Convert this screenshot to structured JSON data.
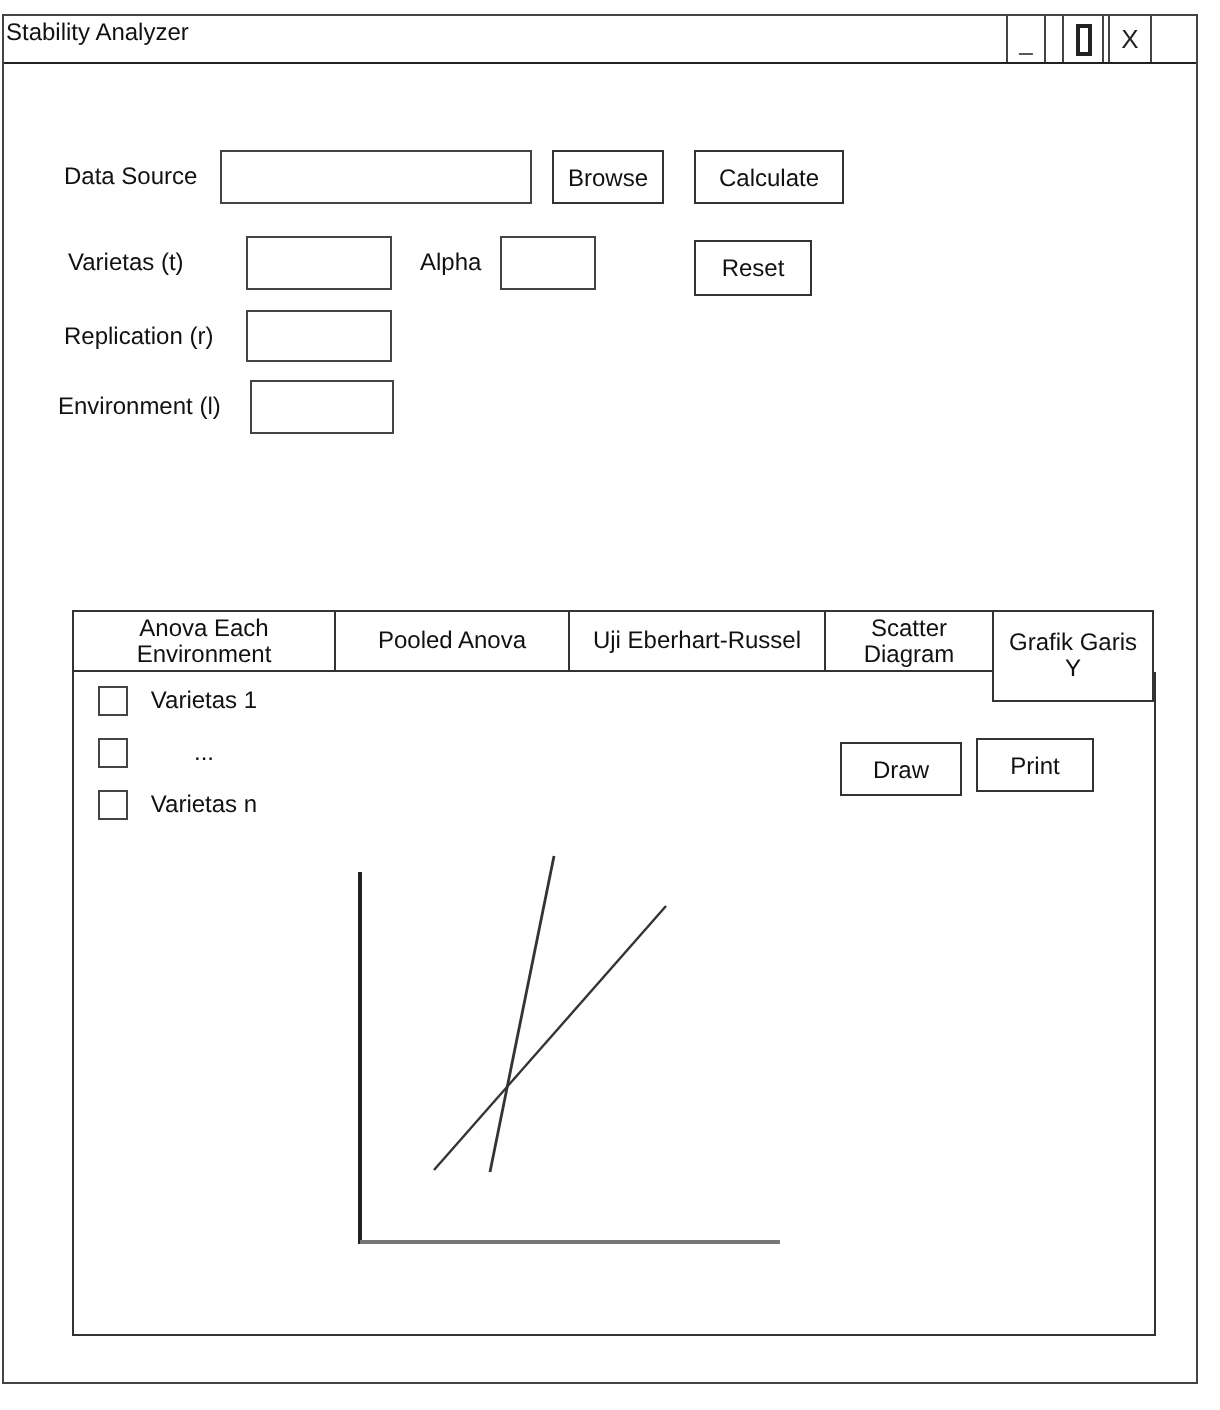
{
  "window": {
    "title": "Stability Analyzer",
    "minimize": "_",
    "close": "X"
  },
  "form": {
    "data_source": {
      "label": "Data Source"
    },
    "browse": "Browse",
    "calculate": "Calculate",
    "varietas": {
      "label": "Varietas (t)"
    },
    "alpha": {
      "label": "Alpha"
    },
    "reset": "Reset",
    "replication": {
      "label": "Replication (r)"
    },
    "environment": {
      "label": "Environment (l)"
    }
  },
  "tabs": [
    {
      "label": "Anova Each Environment",
      "selected": false
    },
    {
      "label": "Pooled Anova",
      "selected": false
    },
    {
      "label": "Uji Eberhart-Russel",
      "selected": false
    },
    {
      "label": "Scatter Diagram",
      "selected": false
    },
    {
      "label": "Grafik Garis Y",
      "selected": true
    }
  ],
  "checkboxes": [
    {
      "label": "Varietas 1",
      "checked": false
    },
    {
      "label": "...",
      "checked": false
    },
    {
      "label": "Varietas n",
      "checked": false
    }
  ],
  "buttons": [
    {
      "label": "Draw"
    },
    {
      "label": "Print"
    }
  ]
}
